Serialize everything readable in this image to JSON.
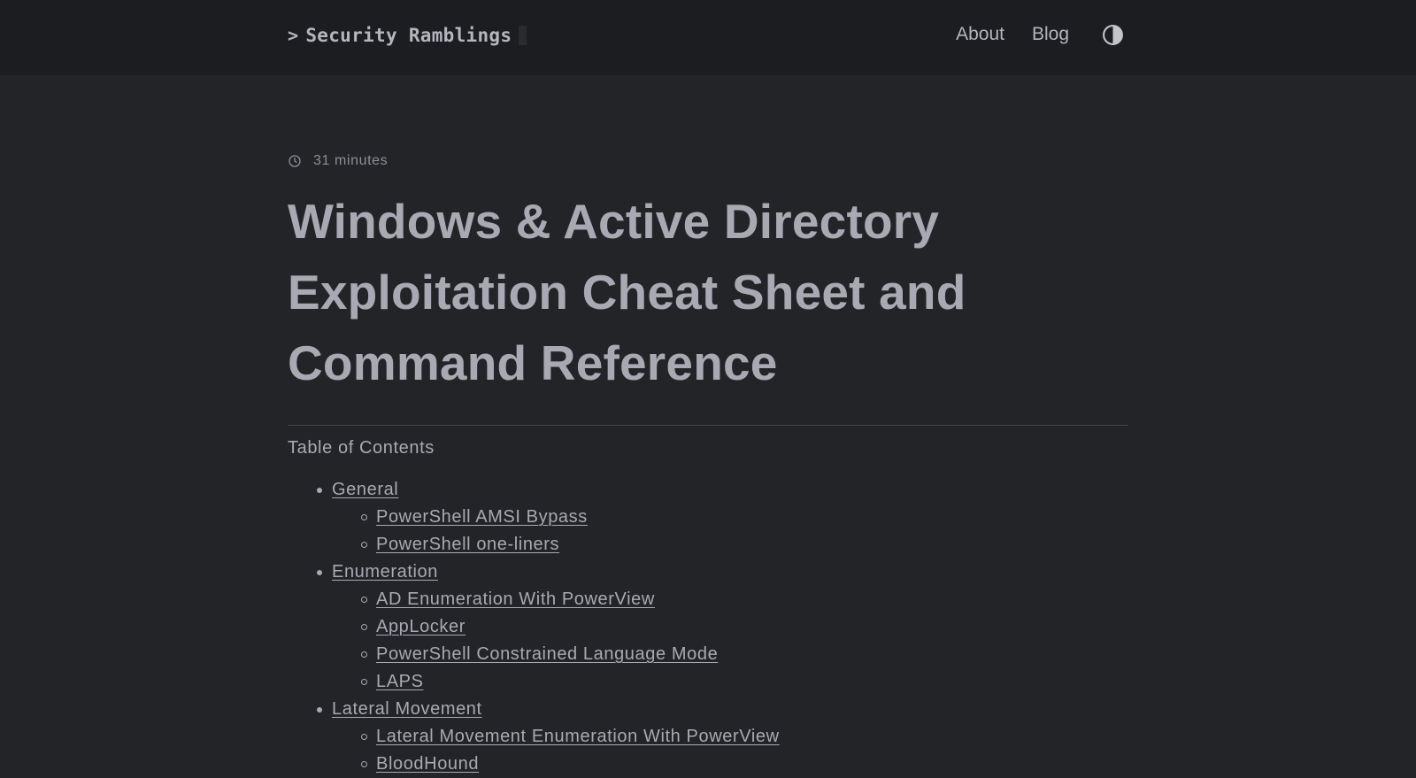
{
  "header": {
    "logo_prompt": ">",
    "logo_text": "Security Ramblings",
    "nav": {
      "about": "About",
      "blog": "Blog"
    },
    "theme_icon": "contrast-half-circle-icon"
  },
  "post": {
    "reading_time": "31 minutes",
    "reading_time_icon": "clock-icon",
    "title": "Windows & Active Directory Exploitation Cheat Sheet and Command Reference"
  },
  "toc": {
    "heading": "Table of Contents",
    "sections": [
      {
        "label": "General",
        "items": [
          "PowerShell AMSI Bypass",
          "PowerShell one-liners"
        ]
      },
      {
        "label": "Enumeration",
        "items": [
          "AD Enumeration With PowerView",
          "AppLocker",
          "PowerShell Constrained Language Mode",
          "LAPS"
        ]
      },
      {
        "label": "Lateral Movement",
        "items": [
          "Lateral Movement Enumeration With PowerView",
          "BloodHound"
        ]
      }
    ]
  },
  "colors": {
    "page_background": "#232427",
    "header_background": "#1c1d20",
    "text": "#a9a9b3"
  }
}
